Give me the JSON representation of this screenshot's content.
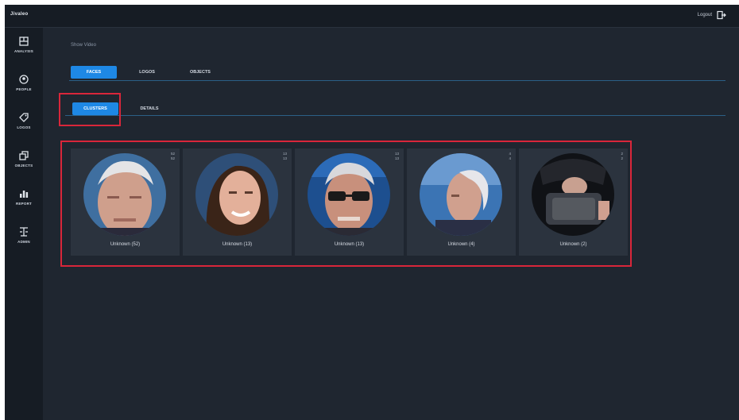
{
  "app": {
    "brand": "Jivaleo",
    "logout_label": "Logout"
  },
  "sidebar": {
    "items": [
      {
        "label": "ANALYSIS",
        "icon": "analysis-icon"
      },
      {
        "label": "PEOPLE",
        "icon": "people-icon"
      },
      {
        "label": "LOGOS",
        "icon": "tag-icon"
      },
      {
        "label": "OBJECTS",
        "icon": "objects-icon"
      },
      {
        "label": "REPORT",
        "icon": "bar-chart-icon"
      },
      {
        "label": "ADMIN",
        "icon": "admin-icon"
      }
    ]
  },
  "main": {
    "breadcrumb": "Show Video",
    "tabs": [
      {
        "label": "FACES",
        "active": true
      },
      {
        "label": "LOGOS",
        "active": false
      },
      {
        "label": "OBJECTS",
        "active": false
      }
    ],
    "subtabs": [
      {
        "label": "CLUSTERS",
        "active": true
      },
      {
        "label": "DETAILS",
        "active": false
      }
    ],
    "clusters": [
      {
        "label": "Unknown (52)",
        "count_a": "52",
        "count_b": "52"
      },
      {
        "label": "Unknown (13)",
        "count_a": "13",
        "count_b": "13"
      },
      {
        "label": "Unknown (13)",
        "count_a": "13",
        "count_b": "13"
      },
      {
        "label": "Unknown (4)",
        "count_a": "4",
        "count_b": "4"
      },
      {
        "label": "Unknown (2)",
        "count_a": "2",
        "count_b": "2"
      }
    ]
  },
  "colors": {
    "accent": "#1e88e5",
    "highlight": "#d9263a",
    "background": "#1f2630",
    "card": "#2b333e"
  }
}
